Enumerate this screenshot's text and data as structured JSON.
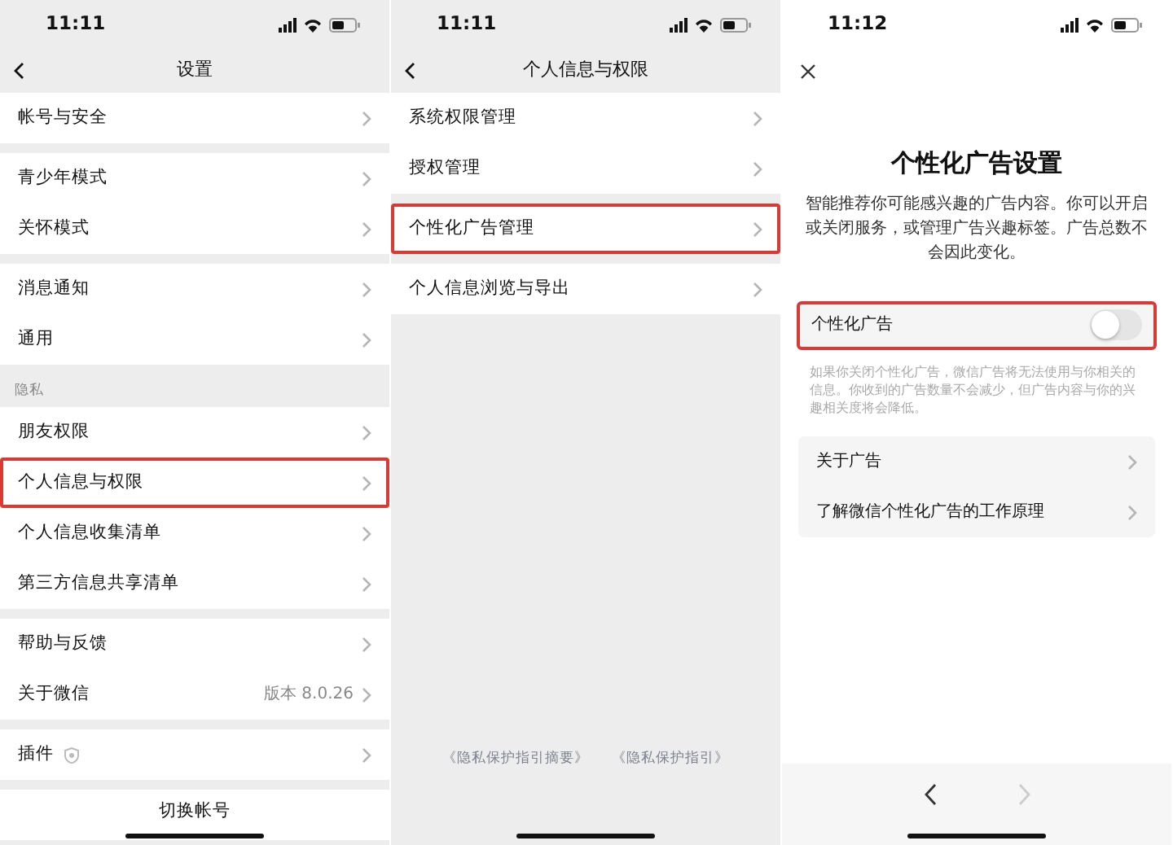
{
  "panels": [
    {
      "kind": "list",
      "status_time": "11:11",
      "title": "设置",
      "groups": [
        {
          "rows": [
            {
              "kind": "link",
              "label": "帐号与安全",
              "highlighted": false
            }
          ]
        },
        {
          "rows": [
            {
              "kind": "link",
              "label": "青少年模式",
              "highlighted": false
            },
            {
              "kind": "link",
              "label": "关怀模式",
              "highlighted": false
            }
          ]
        },
        {
          "rows": [
            {
              "kind": "link",
              "label": "消息通知",
              "highlighted": false
            },
            {
              "kind": "link",
              "label": "通用",
              "highlighted": false
            }
          ]
        },
        {
          "header": "隐私",
          "rows": [
            {
              "kind": "link",
              "label": "朋友权限",
              "highlighted": false
            },
            {
              "kind": "link",
              "label": "个人信息与权限",
              "highlighted": true
            },
            {
              "kind": "link",
              "label": "个人信息收集清单",
              "highlighted": false
            },
            {
              "kind": "link",
              "label": "第三方信息共享清单",
              "highlighted": false
            }
          ]
        },
        {
          "rows": [
            {
              "kind": "link",
              "label": "帮助与反馈",
              "highlighted": false
            },
            {
              "kind": "link",
              "label": "关于微信",
              "value": "版本 8.0.26",
              "highlighted": false
            }
          ]
        },
        {
          "rows": [
            {
              "kind": "plugin",
              "label": "插件",
              "highlighted": false
            }
          ]
        },
        {
          "rows": [
            {
              "kind": "center",
              "label": "切换帐号",
              "highlighted": false
            }
          ]
        }
      ]
    },
    {
      "kind": "list",
      "status_time": "11:11",
      "title": "个人信息与权限",
      "groups": [
        {
          "rows": [
            {
              "kind": "link",
              "label": "系统权限管理",
              "highlighted": false
            },
            {
              "kind": "link",
              "label": "授权管理",
              "highlighted": false
            }
          ]
        },
        {
          "rows": [
            {
              "kind": "link",
              "label": "个性化广告管理",
              "highlighted": true
            }
          ]
        },
        {
          "rows": [
            {
              "kind": "link",
              "label": "个人信息浏览与导出",
              "highlighted": false
            }
          ]
        }
      ],
      "footer_links": [
        "《隐私保护指引摘要》",
        "《隐私保护指引》"
      ]
    },
    {
      "kind": "detail",
      "status_time": "11:12",
      "title": "个性化广告设置",
      "description": "智能推荐你可能感兴趣的广告内容。你可以开启或关闭服务，或管理广告兴趣标签。广告总数不会因此变化。",
      "toggle": {
        "label": "个性化广告",
        "on": false,
        "highlighted": true
      },
      "hint": "如果你关闭个性化广告，微信广告将无法使用与你相关的信息。你收到的广告数量不会减少，但广告内容与你的兴趣相关度将会降低。",
      "rows": [
        {
          "kind": "link",
          "label": "关于广告",
          "highlighted": false
        },
        {
          "kind": "link",
          "label": "了解微信个性化广告的工作原理",
          "highlighted": false
        }
      ],
      "toolbar": {
        "back_disabled": false,
        "forward_disabled": true
      }
    }
  ]
}
